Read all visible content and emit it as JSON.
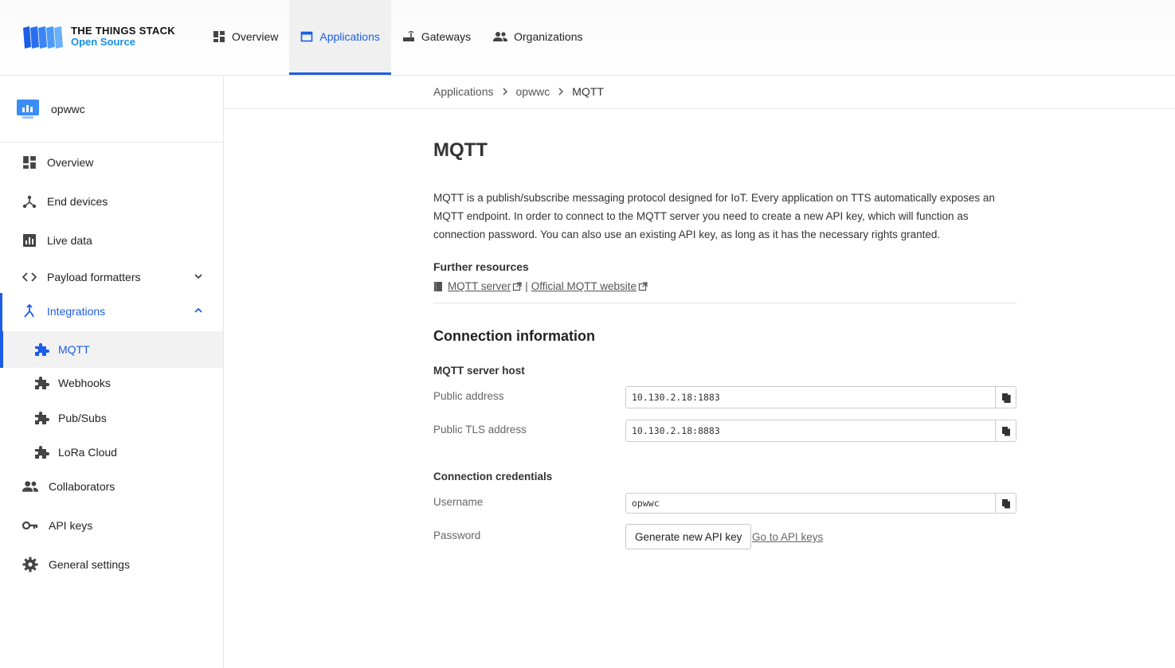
{
  "brand": {
    "line1": "THE THINGS STACK",
    "line2": "Open Source"
  },
  "topnav": {
    "items": [
      {
        "label": "Overview",
        "icon": "dashboard-icon"
      },
      {
        "label": "Applications",
        "icon": "window-icon",
        "active": true
      },
      {
        "label": "Gateways",
        "icon": "router-icon"
      },
      {
        "label": "Organizations",
        "icon": "people-icon"
      }
    ]
  },
  "sidebar": {
    "app_name": "opwwc",
    "items": {
      "overview": "Overview",
      "end_devices": "End devices",
      "live_data": "Live data",
      "payload_formatters": "Payload formatters",
      "integrations": "Integrations",
      "mqtt": "MQTT",
      "webhooks": "Webhooks",
      "pubsubs": "Pub/Subs",
      "lora_cloud": "LoRa Cloud",
      "collaborators": "Collaborators",
      "api_keys": "API keys",
      "general_settings": "General settings"
    }
  },
  "breadcrumb": {
    "first": "Applications",
    "second": "opwwc",
    "current": "MQTT"
  },
  "main": {
    "title": "MQTT",
    "description": "MQTT is a publish/subscribe messaging protocol designed for IoT. Every application on TTS automatically exposes an MQTT endpoint. In order to connect to the MQTT server you need to create a new API key, which will function as connection password. You can also use an existing API key, as long as it has the necessary rights granted.",
    "further_resources": "Further resources",
    "link_mqtt_server": "MQTT server",
    "link_official": "Official MQTT website",
    "link_separator": "|",
    "connection_info": "Connection information",
    "server_host": "MQTT server host",
    "public_address_label": "Public address",
    "public_address": "10.130.2.18:1883",
    "public_tls_label": "Public TLS address",
    "public_tls": "10.130.2.18:8883",
    "credentials": "Connection credentials",
    "username_label": "Username",
    "username": "opwwc",
    "password_label": "Password",
    "generate_button": "Generate new API key",
    "goto_api_keys": "Go to API keys"
  },
  "colors": {
    "accent": "#1c5de6",
    "brand_blue": "#1a8fe8"
  }
}
